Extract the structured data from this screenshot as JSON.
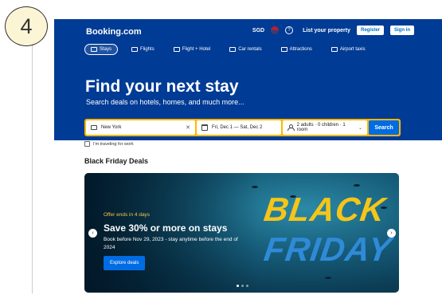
{
  "step": "4",
  "header": {
    "brand": "Booking.com",
    "currency": "SGD",
    "help_icon": "?",
    "list_property": "List your property",
    "register": "Register",
    "sign_in": "Sign in"
  },
  "nav": [
    {
      "label": "Stays",
      "icon": "bed-icon"
    },
    {
      "label": "Flights",
      "icon": "plane-icon"
    },
    {
      "label": "Flight + Hotel",
      "icon": "flight-hotel-icon"
    },
    {
      "label": "Car rentals",
      "icon": "car-icon"
    },
    {
      "label": "Attractions",
      "icon": "attractions-icon"
    },
    {
      "label": "Airport taxis",
      "icon": "taxi-icon"
    }
  ],
  "hero": {
    "title": "Find your next stay",
    "subtitle": "Search deals on hotels, homes, and much more..."
  },
  "search": {
    "destination": "New York",
    "dates": "Fri, Dec 1 — Sat, Dec 2",
    "guests": "2 adults · 0 children · 1 room",
    "button": "Search",
    "work_travel": "I'm traveling for work"
  },
  "deals": {
    "section_title": "Black Friday Deals",
    "offer_ends": "Offer ends in 4 days",
    "headline": "Save 30% or more on stays",
    "description": "Book before Nov 29, 2023 - stay anytime before the end of 2024",
    "cta": "Explore deals",
    "art_line1": "BLACK",
    "art_line2": "FRIDAY"
  },
  "colors": {
    "brand_blue": "#003b95",
    "search_yellow": "#ffb700",
    "action_blue": "#006ce4"
  }
}
